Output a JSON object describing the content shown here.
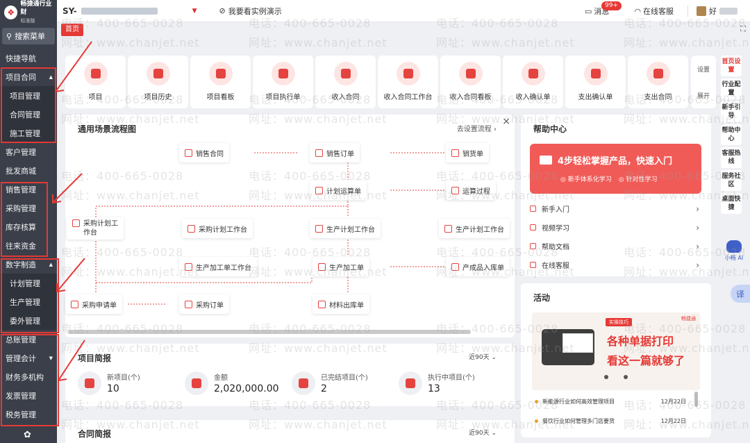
{
  "sidebar": {
    "logo_text": "畅捷通行业财",
    "edition": "标准版",
    "search_label": "搜索菜单",
    "items": [
      {
        "label": "快捷导航",
        "sub": false
      },
      {
        "label": "项目合同",
        "sub": false,
        "expanded": true
      },
      {
        "label": "项目管理",
        "sub": true
      },
      {
        "label": "合同管理",
        "sub": true
      },
      {
        "label": "施工管理",
        "sub": true
      },
      {
        "label": "客户管理",
        "sub": false
      },
      {
        "label": "批发商城",
        "sub": false
      },
      {
        "label": "销售管理",
        "sub": false
      },
      {
        "label": "采购管理",
        "sub": false
      },
      {
        "label": "库存核算",
        "sub": false
      },
      {
        "label": "往来资金",
        "sub": false
      },
      {
        "label": "数字制造",
        "sub": false,
        "expanded": true
      },
      {
        "label": "计划管理",
        "sub": true
      },
      {
        "label": "生产管理",
        "sub": true
      },
      {
        "label": "委外管理",
        "sub": true
      },
      {
        "label": "总账管理",
        "sub": false
      },
      {
        "label": "管理会计",
        "sub": false,
        "collapsed": true
      },
      {
        "label": "财务多机构",
        "sub": false
      },
      {
        "label": "发票管理",
        "sub": false
      },
      {
        "label": "税务管理",
        "sub": false
      }
    ]
  },
  "header": {
    "company_prefix": "SY-",
    "demo_label": "我要看实例演示",
    "messages_label": "消息",
    "messages_count": "99+",
    "service_label": "在线客服",
    "user_label": "好"
  },
  "tabs": {
    "home": "首页"
  },
  "shortcuts": [
    {
      "label": "项目"
    },
    {
      "label": "项目历史"
    },
    {
      "label": "项目看板"
    },
    {
      "label": "项目执行单"
    },
    {
      "label": "收入合同"
    },
    {
      "label": "收入合同工作台"
    },
    {
      "label": "收入合同看板"
    },
    {
      "label": "收入确认单"
    },
    {
      "label": "支出确认单"
    },
    {
      "label": "支出合同"
    }
  ],
  "shortcut_side": {
    "settings": "设置",
    "expand": "展开"
  },
  "rail": [
    {
      "label": "首页设置",
      "active": true
    },
    {
      "label": "行业配置",
      "active": false
    },
    {
      "label": "新手引导",
      "active": false
    },
    {
      "label": "帮助中心",
      "active": false
    },
    {
      "label": "客服热线",
      "active": false
    },
    {
      "label": "服务社区",
      "active": false
    },
    {
      "label": "桌面快捷",
      "active": false
    }
  ],
  "robot_label": "小畅 AI",
  "translate_label": "译",
  "flow": {
    "title": "通用场景流程图",
    "settings_link": "去设置流程",
    "nodes": {
      "sales_contract": "销售合同",
      "sales_order": "销售订单",
      "delivery": "销货单",
      "plan_calc": "计划运算单",
      "calc_process": "运算过程",
      "purchase_plan_ws_1": "采购计划工",
      "purchase_plan_ws_2": "作台",
      "purchase_plan_ws": "采购计划工作台",
      "production_plan_ws": "生产计划工作台",
      "production_plan_ws2": "生产计划工作台",
      "work_order_ws": "生产加工单工作台",
      "work_order": "生产加工单",
      "finished_in": "产成品入库单",
      "purchase_request": "采购申请单",
      "purchase_order": "采购订单",
      "material_out": "材料出库单"
    }
  },
  "help": {
    "title": "帮助中心",
    "banner_title": "4步轻松掌握产品，快速入门",
    "banner_sub1": "新手体系化学习",
    "banner_sub2": "针对性学习",
    "items": [
      {
        "label": "新手入门"
      },
      {
        "label": "视频学习"
      },
      {
        "label": "帮助文档"
      },
      {
        "label": "在线客服"
      }
    ]
  },
  "activity": {
    "title": "活动",
    "img_tag": "实操技巧",
    "img_brand": "畅捷通",
    "img_line1": "各种单据打印",
    "img_line2": "看这一篇就够了",
    "items": [
      {
        "title": "新能源行业如何高效管理项目",
        "date": "12月22日"
      },
      {
        "title": "餐饮行业如何管理多门店要货",
        "date": "12月22日"
      }
    ]
  },
  "project_summary": {
    "title": "项目简报",
    "range": "近90天",
    "stats": [
      {
        "label": "新项目(个)",
        "value": "10"
      },
      {
        "label": "金额",
        "value": "2,020,000.00"
      },
      {
        "label": "已完结项目(个)",
        "value": "2"
      },
      {
        "label": "执行中项目(个)",
        "value": "13"
      }
    ]
  },
  "contract_summary": {
    "title": "合同简报",
    "range": "近90天"
  },
  "watermark": {
    "phone": "电话：400-665-0028",
    "site": "网址：www.chanjet.net"
  },
  "colors": {
    "accent": "#e53935",
    "sidebar_bg": "#3a3f4a",
    "page_bg": "#eef0f4"
  }
}
